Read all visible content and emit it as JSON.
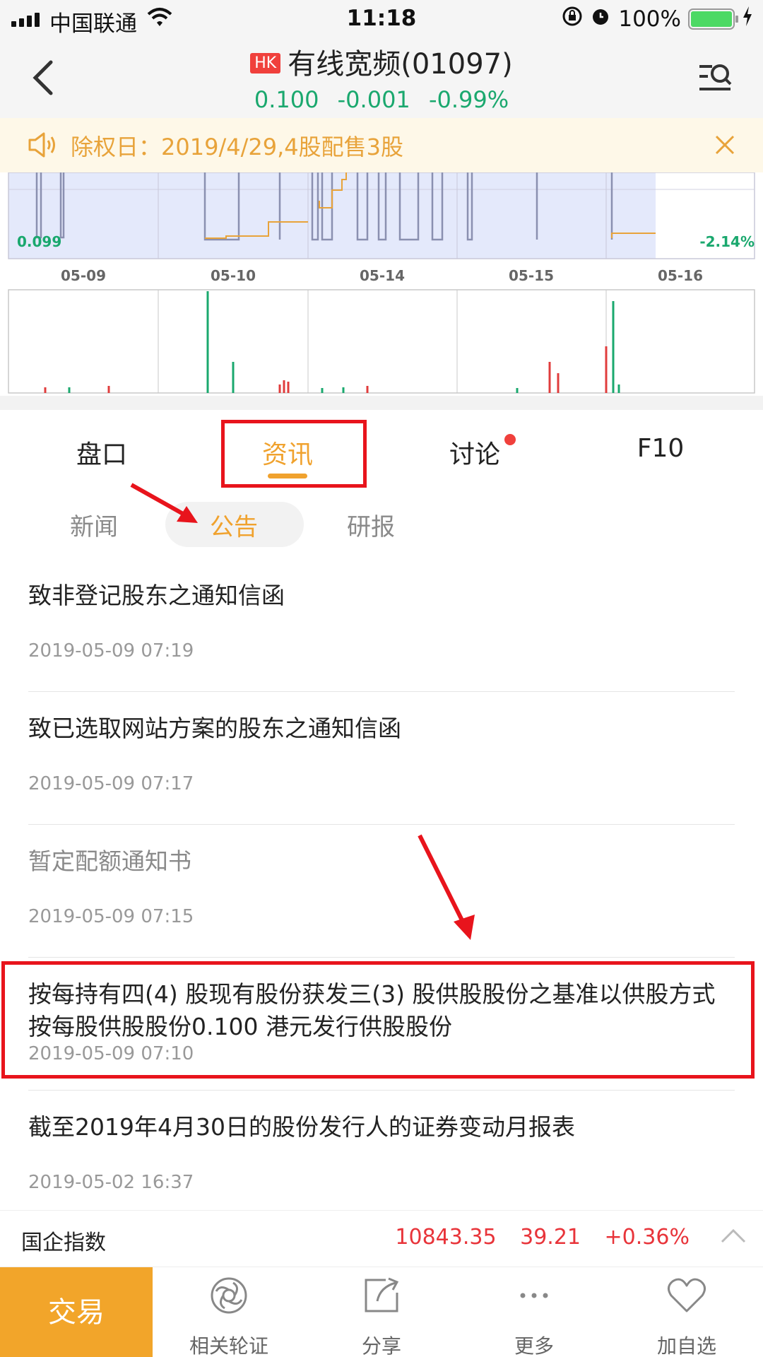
{
  "status_bar": {
    "carrier": "中国联通",
    "time": "11:18",
    "battery": "100%"
  },
  "header": {
    "market_badge": "HK",
    "title": "有线宽频(01097)",
    "price": "0.100",
    "change": "-0.001",
    "change_pct": "-0.99%"
  },
  "notice": {
    "text": "除权日：2019/4/29,4股配售3股"
  },
  "chart": {
    "left_label": "0.099",
    "right_label": "-2.14%",
    "dates": [
      "05-09",
      "05-10",
      "05-14",
      "05-15",
      "05-16"
    ]
  },
  "tabs": [
    {
      "label": "盘口"
    },
    {
      "label": "资讯"
    },
    {
      "label": "讨论"
    },
    {
      "label": "F10"
    }
  ],
  "active_tab": "资讯",
  "subtabs": [
    {
      "label": "新闻"
    },
    {
      "label": "公告"
    },
    {
      "label": "研报"
    }
  ],
  "active_subtab": "公告",
  "announcements": [
    {
      "title": "致非登记股东之通知信函",
      "date": "2019-05-09 07:19"
    },
    {
      "title": "致已选取网站方案的股东之通知信函",
      "date": "2019-05-09 07:17"
    },
    {
      "title": "暂定配额通知书",
      "date": "2019-05-09 07:15"
    },
    {
      "title": "按每持有四(4) 股现有股份获发三(3) 股供股股份之基准以供股方式按每股供股股份0.100 港元发行供股股份",
      "date": "2019-05-09 07:10"
    },
    {
      "title": "截至2019年4月30日的股份发行人的证券变动月报表",
      "date": "2019-05-02 16:37"
    }
  ],
  "index_bar": {
    "name": "国企指数",
    "value": "10843.35",
    "change": "39.21",
    "change_pct": "+0.36%"
  },
  "bottom_bar": {
    "trade": "交易",
    "items": [
      {
        "label": "相关轮证",
        "icon": "warrant-icon"
      },
      {
        "label": "分享",
        "icon": "share-icon"
      },
      {
        "label": "更多",
        "icon": "more-icon"
      },
      {
        "label": "加自选",
        "icon": "heart-icon"
      }
    ]
  },
  "colors": {
    "accent": "#f0a22e",
    "down_green": "#1aa86e",
    "up_red": "#e8343a",
    "highlight_red": "#e8141c"
  }
}
